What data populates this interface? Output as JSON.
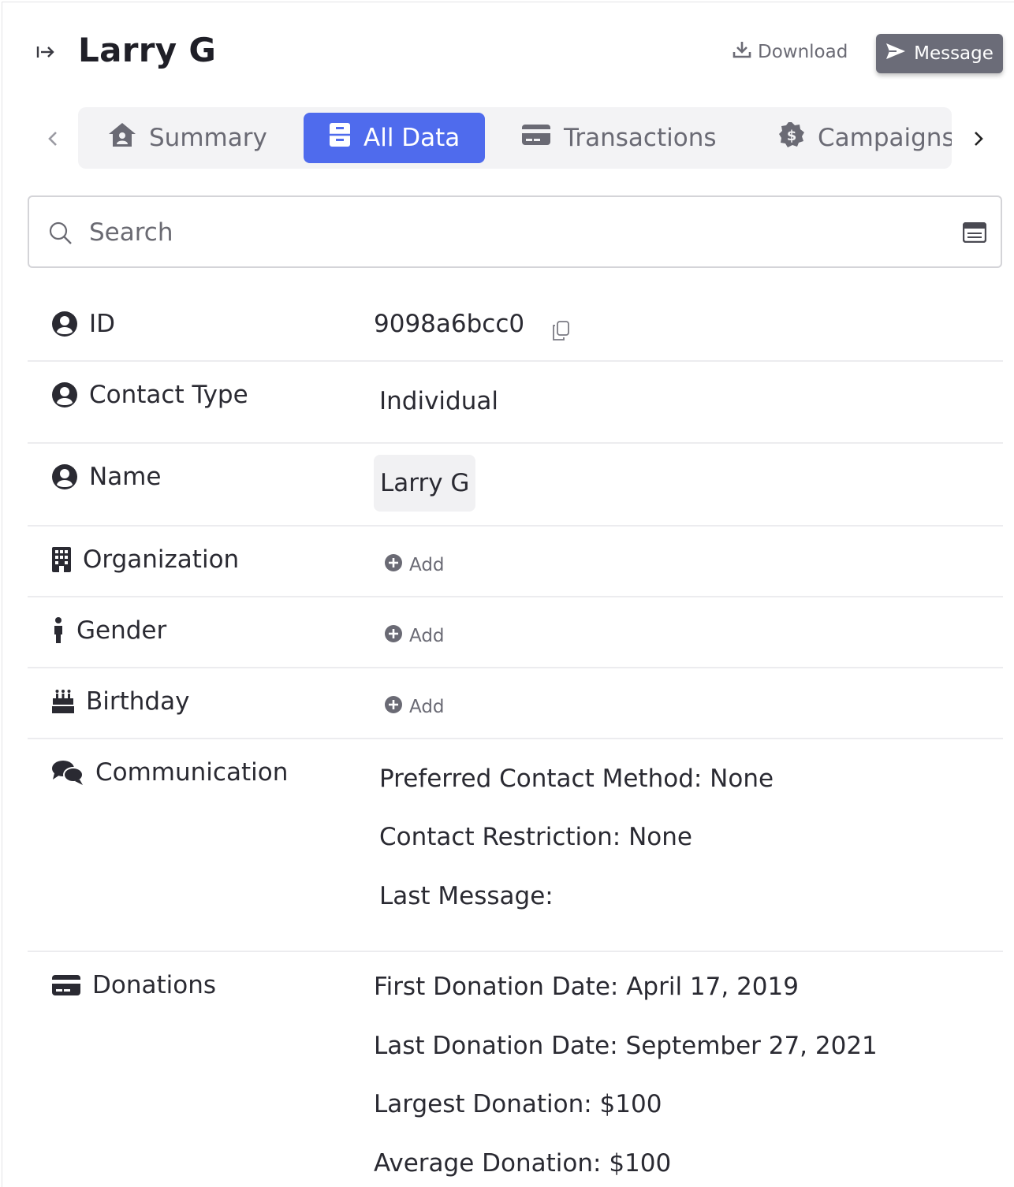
{
  "header": {
    "title": "Larry G",
    "download_label": "Download",
    "message_label": "Message"
  },
  "tabs": [
    {
      "label": "Summary",
      "icon": "house-user-icon",
      "active": false
    },
    {
      "label": "All Data",
      "icon": "archive-icon",
      "active": true
    },
    {
      "label": "Transactions",
      "icon": "credit-card-icon",
      "active": false
    },
    {
      "label": "Campaigns",
      "icon": "dollar-badge-icon",
      "active": false
    }
  ],
  "search": {
    "placeholder": "Search",
    "value": ""
  },
  "fields": {
    "id": {
      "label": "ID",
      "value": "9098a6bcc0"
    },
    "contact_type": {
      "label": "Contact Type",
      "value": "Individual"
    },
    "name": {
      "label": "Name",
      "value": "Larry G"
    },
    "organization": {
      "label": "Organization",
      "add_label": "Add"
    },
    "gender": {
      "label": "Gender",
      "add_label": "Add"
    },
    "birthday": {
      "label": "Birthday",
      "add_label": "Add"
    },
    "communication": {
      "label": "Communication",
      "lines": [
        "Preferred Contact Method: None",
        "Contact Restriction: None",
        "Last Message:"
      ]
    },
    "donations": {
      "label": "Donations",
      "lines": [
        "First Donation Date: April 17, 2019",
        "Last Donation Date: September 27, 2021",
        "Largest Donation: $100",
        "Average Donation: $100"
      ]
    }
  },
  "colors": {
    "accent": "#4f6bed",
    "message_button": "#6b6c78",
    "divider": "#ececef"
  }
}
